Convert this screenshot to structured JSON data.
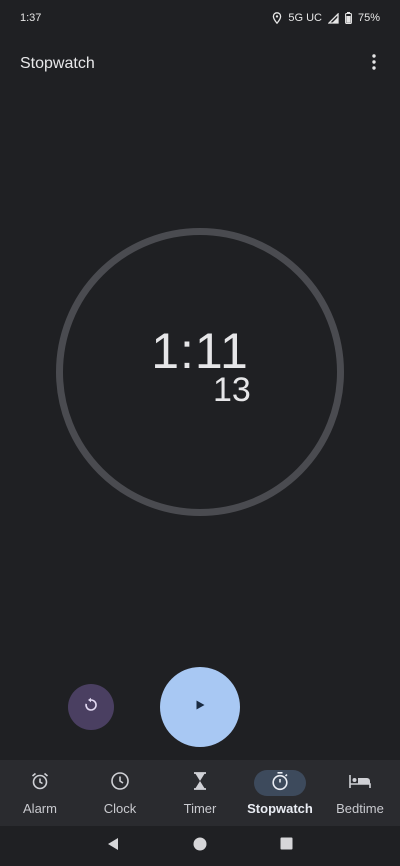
{
  "status": {
    "time": "1:37",
    "network": "5G UC",
    "battery": "75%"
  },
  "app_bar": {
    "title": "Stopwatch"
  },
  "stopwatch": {
    "elapsed": "1:11",
    "hundredths": "13"
  },
  "controls": {
    "reset_icon": "reset-icon",
    "play_icon": "play-icon"
  },
  "bottom_nav": {
    "items": [
      {
        "label": "Alarm",
        "icon": "alarm-clock-icon"
      },
      {
        "label": "Clock",
        "icon": "clock-icon"
      },
      {
        "label": "Timer",
        "icon": "hourglass-icon"
      },
      {
        "label": "Stopwatch",
        "icon": "stopwatch-icon",
        "active": true
      },
      {
        "label": "Bedtime",
        "icon": "bed-icon"
      }
    ]
  },
  "colors": {
    "background": "#1f2023",
    "dial_ring": "#4a4b50",
    "play_button": "#a8c8f3",
    "reset_button": "#4a3f61",
    "nav_bar": "#2a2b2f",
    "active_pill": "#3d4a5c"
  }
}
